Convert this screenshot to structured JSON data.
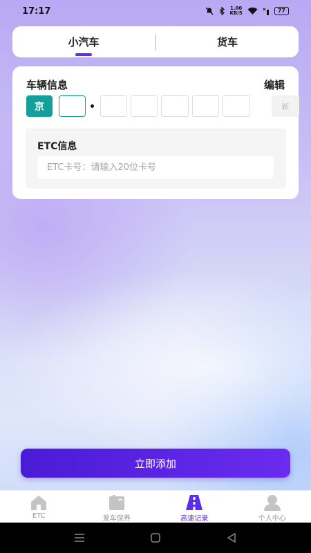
{
  "status_bar": {
    "time": "17:17",
    "net_speed_value": "1.00",
    "net_speed_unit": "KB/S",
    "battery": "77"
  },
  "tabs": [
    {
      "label": "小汽车",
      "active": true
    },
    {
      "label": "货车",
      "active": false
    }
  ],
  "vehicle": {
    "title": "车辆信息",
    "edit_label": "编辑",
    "plate_province": "京",
    "plate_new_label": "新",
    "etc_title": "ETC信息",
    "etc_placeholder": "ETC卡号：请输入20位卡号"
  },
  "add_button_label": "立即添加",
  "bottom_nav": [
    {
      "label": "ETC",
      "icon": "home-icon",
      "active": false
    },
    {
      "label": "爱车保养",
      "icon": "car-care-icon",
      "active": false
    },
    {
      "label": "高速记录",
      "icon": "highway-icon",
      "active": true
    },
    {
      "label": "个人中心",
      "icon": "person-icon",
      "active": false
    }
  ],
  "colors": {
    "accent": "#5b2ee8",
    "plate_green": "#13a09a",
    "nav_inactive": "#999999"
  }
}
